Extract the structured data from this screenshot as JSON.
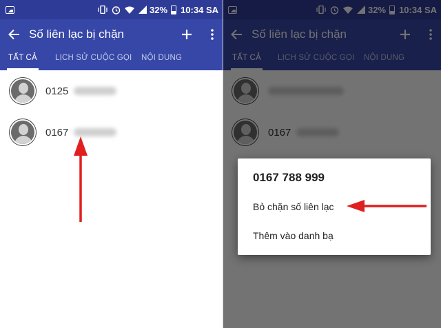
{
  "status_bar": {
    "battery": "32%",
    "time": "10:34 SA"
  },
  "app_bar": {
    "title": "Số liên lạc bị chặn"
  },
  "tabs": [
    {
      "label": "TẤT CẢ",
      "active": true
    },
    {
      "label": "LỊCH SỬ CUỘC GỌI",
      "active": false
    },
    {
      "label": "NỘI DUNG",
      "active": false
    }
  ],
  "contacts": [
    {
      "number_prefix": "0125"
    },
    {
      "number_prefix": "0167"
    }
  ],
  "dialog": {
    "title": "0167 788 999",
    "options": [
      "Bỏ chặn số liên lạc",
      "Thêm vào danh bạ"
    ]
  },
  "colors": {
    "status_bar": "#2f3c97",
    "app_bar": "#3747a7",
    "annotation_arrow": "#e0201f"
  }
}
